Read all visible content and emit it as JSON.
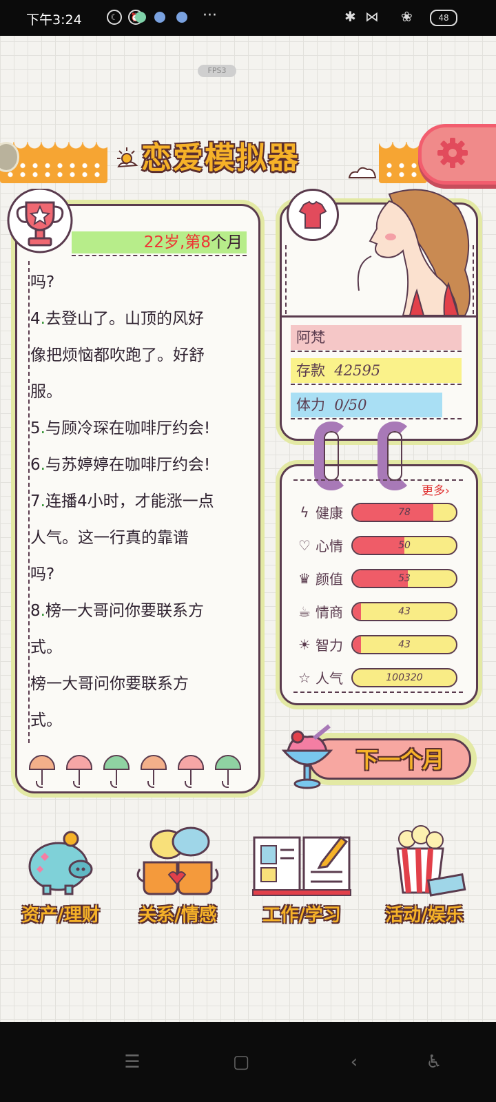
{
  "status_bar": {
    "time": "下午3:24",
    "battery": "48"
  },
  "fps_badge": "FPS3",
  "app": {
    "title": "恋爱模拟器"
  },
  "log": {
    "age_prefix": "22岁,第",
    "age_month": "8",
    "age_suffix": "个月",
    "lines": [
      {
        "num": "",
        "text": "吗?"
      },
      {
        "num": "4.",
        "text": "去登山了。山顶的风好"
      },
      {
        "num": "",
        "text": "像把烦恼都吹跑了。好舒"
      },
      {
        "num": "",
        "text": "服。"
      },
      {
        "num": "5.",
        "text": "与顾冷琛在咖啡厅约会!"
      },
      {
        "num": "6.",
        "text": "与苏婷婷在咖啡厅约会!"
      },
      {
        "num": "7.",
        "text": "连播4小时，才能涨一点"
      },
      {
        "num": "",
        "text": "人气。这一行真的靠谱"
      },
      {
        "num": "",
        "text": "吗?"
      },
      {
        "num": "8.",
        "text": "榜一大哥问你要联系方"
      },
      {
        "num": "",
        "text": "式。"
      },
      {
        "num": "",
        "text": "榜一大哥问你要联系方"
      },
      {
        "num": "",
        "text": "式。"
      }
    ]
  },
  "profile": {
    "name": "阿梵",
    "savings_label": "存款",
    "savings_value": "42595",
    "stamina_label": "体力",
    "stamina_value": "0/50"
  },
  "stats": {
    "more_label": "更多›",
    "items": [
      {
        "label": "健康",
        "value": "78",
        "fill": 0.78,
        "icon": "lightning-icon"
      },
      {
        "label": "心情",
        "value": "50",
        "fill": 0.5,
        "icon": "heart-icon"
      },
      {
        "label": "颜值",
        "value": "53",
        "fill": 0.53,
        "icon": "crown-icon"
      },
      {
        "label": "情商",
        "value": "43",
        "fill": 0.08,
        "icon": "cup-icon"
      },
      {
        "label": "智力",
        "value": "43",
        "fill": 0.08,
        "icon": "bulb-icon"
      },
      {
        "label": "人气",
        "value": "100320",
        "fill": 0.0,
        "icon": "star-icon"
      }
    ]
  },
  "next_month_button": "下一个月",
  "bottom_menu": [
    {
      "label": "资产/理财",
      "icon": "piggy-bank-icon"
    },
    {
      "label": "关系/情感",
      "icon": "coffee-cups-icon"
    },
    {
      "label": "工作/学习",
      "icon": "book-icon"
    },
    {
      "label": "活动/娱乐",
      "icon": "popcorn-icon"
    }
  ],
  "colors": {
    "accent": "#f6b228",
    "outline": "#5a3b4e",
    "panel_border": "#e3e9a4",
    "bar_fill": "#ef5c68",
    "bar_empty": "#f9ec86"
  }
}
